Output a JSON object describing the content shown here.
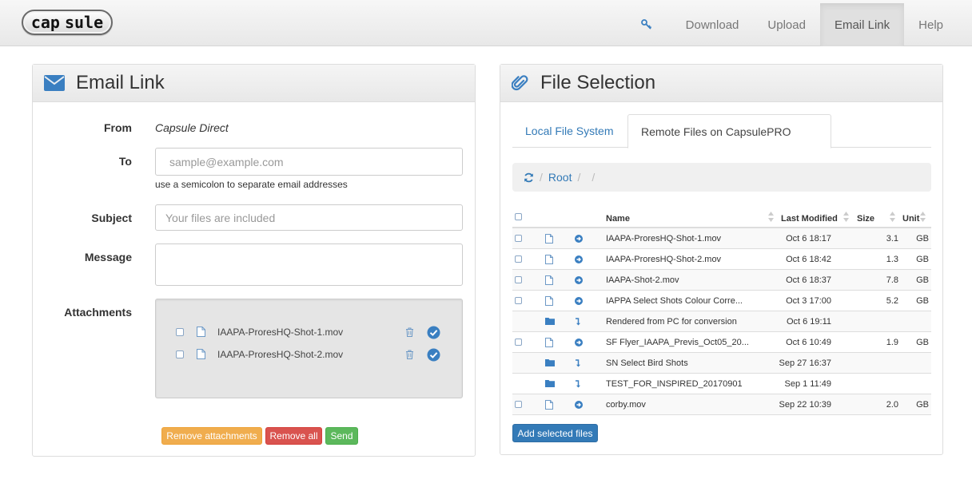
{
  "brand": {
    "logo_text_a": "cap",
    "logo_text_b": "sule"
  },
  "nav": {
    "items": [
      {
        "label": "Download"
      },
      {
        "label": "Upload"
      },
      {
        "label": "Email Link",
        "active": true
      },
      {
        "label": "Help"
      }
    ]
  },
  "email_panel": {
    "title": "Email Link",
    "from_label": "From",
    "from_value": "Capsule Direct",
    "to_label": "To",
    "to_placeholder": "sample@example.com",
    "to_help": "use a semicolon to separate email addresses",
    "subject_label": "Subject",
    "subject_placeholder": "Your files are included",
    "message_label": "Message",
    "message_value": "",
    "attachments_label": "Attachments",
    "attachments": [
      {
        "name": "IAAPA-ProresHQ-Shot-1.mov"
      },
      {
        "name": "IAAPA-ProresHQ-Shot-2.mov"
      }
    ],
    "buttons": {
      "remove_attachments": "Remove attachments",
      "remove_all": "Remove all",
      "send": "Send"
    }
  },
  "file_panel": {
    "title": "File Selection",
    "tabs": [
      {
        "label": "Local File System",
        "active": false
      },
      {
        "label": "Remote Files on CapsulePRO",
        "active": true
      }
    ],
    "breadcrumb": {
      "sep1": "/",
      "root": "Root",
      "sep2": "/",
      "sep3": "/"
    },
    "columns": {
      "name": "Name",
      "modified": "Last Modified",
      "size": "Size",
      "unit": "Unit"
    },
    "rows": [
      {
        "type": "file",
        "name": "IAAPA-ProresHQ-Shot-1.mov",
        "modified": "Oct 6 18:17",
        "size": "3.1",
        "unit": "GB"
      },
      {
        "type": "file",
        "name": "IAAPA-ProresHQ-Shot-2.mov",
        "modified": "Oct 6 18:42",
        "size": "1.3",
        "unit": "GB"
      },
      {
        "type": "file",
        "name": "IAAPA-Shot-2.mov",
        "modified": "Oct 6 18:37",
        "size": "7.8",
        "unit": "GB"
      },
      {
        "type": "file",
        "name": "IAPPA Select Shots Colour Corre...",
        "modified": "Oct 3 17:00",
        "size": "5.2",
        "unit": "GB"
      },
      {
        "type": "folder",
        "name": "Rendered from PC for conversion",
        "modified": "Oct 6 19:11",
        "size": "",
        "unit": ""
      },
      {
        "type": "file",
        "name": "SF Flyer_IAAPA_Previs_Oct05_20...",
        "modified": "Oct 6 10:49",
        "size": "1.9",
        "unit": "GB"
      },
      {
        "type": "folder",
        "name": "SN Select Bird Shots",
        "modified": "Sep 27 16:37",
        "size": "",
        "unit": ""
      },
      {
        "type": "folder",
        "name": "TEST_FOR_INSPIRED_20170901",
        "modified": "Sep 1 11:49",
        "size": "",
        "unit": ""
      },
      {
        "type": "file",
        "name": "corby.mov",
        "modified": "Sep 22 10:39",
        "size": "2.0",
        "unit": "GB"
      }
    ],
    "add_button": "Add selected files"
  },
  "colors": {
    "accent": "#337ab7",
    "warning": "#f0ad4e",
    "danger": "#d9534f",
    "success": "#5cb85c"
  },
  "icons": {
    "nav_key": "key-icon",
    "email_header": "envelope-icon",
    "file_header": "paperclip-icon",
    "refresh": "refresh-icon",
    "file": "file-icon",
    "folder": "folder-icon",
    "add": "arrow-circle-right-icon",
    "enter": "level-down-icon",
    "delete": "trash-icon",
    "confirm": "check-circle-icon"
  }
}
